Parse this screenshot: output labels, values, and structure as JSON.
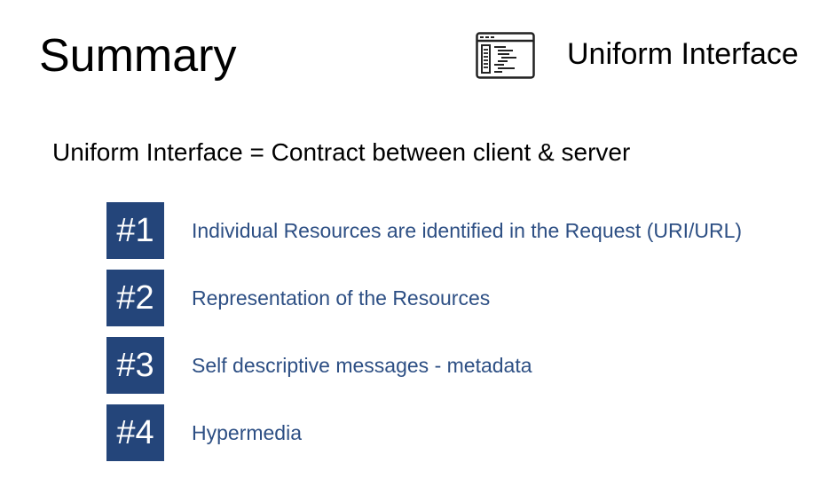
{
  "title": "Summary",
  "topic": {
    "icon": "code-window-icon",
    "label": "Uniform Interface"
  },
  "definition": "Uniform Interface = Contract between client & server",
  "colors": {
    "badge_bg": "#24457a",
    "badge_text": "#ffffff",
    "point_text": "#2d4f84"
  },
  "points": [
    {
      "badge": "#1",
      "text": "Individual Resources are identified in the Request (URI/URL)"
    },
    {
      "badge": "#2",
      "text": "Representation of the Resources"
    },
    {
      "badge": "#3",
      "text": "Self descriptive messages - metadata"
    },
    {
      "badge": "#4",
      "text": "Hypermedia"
    }
  ]
}
